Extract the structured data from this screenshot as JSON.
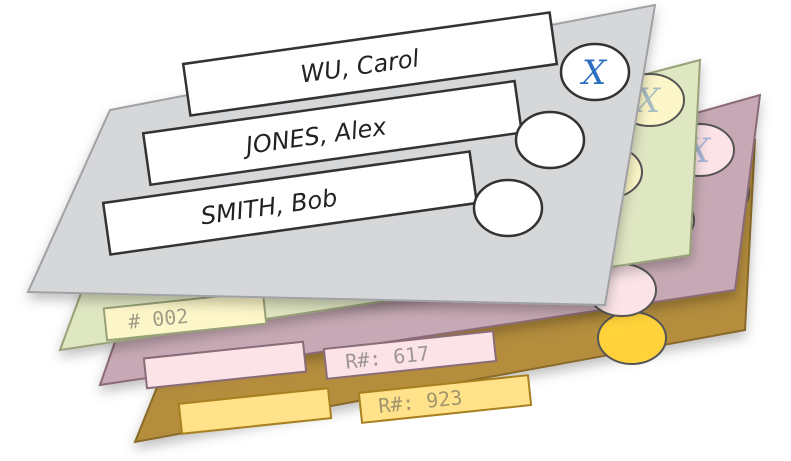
{
  "ballots": {
    "top": {
      "color": "#d6d7d9",
      "candidates": [
        "WU, Carol",
        "JONES, Alex",
        "SMITH, Bob"
      ],
      "mark": "X"
    },
    "layer2": {
      "color": "#dfe6c2",
      "visible_label": "# 002"
    },
    "layer3": {
      "color": "#c6a9b4",
      "visible_label": "R#: 617"
    },
    "layer4": {
      "color": "#b48d3e",
      "visible_label": "R#: 923"
    }
  }
}
